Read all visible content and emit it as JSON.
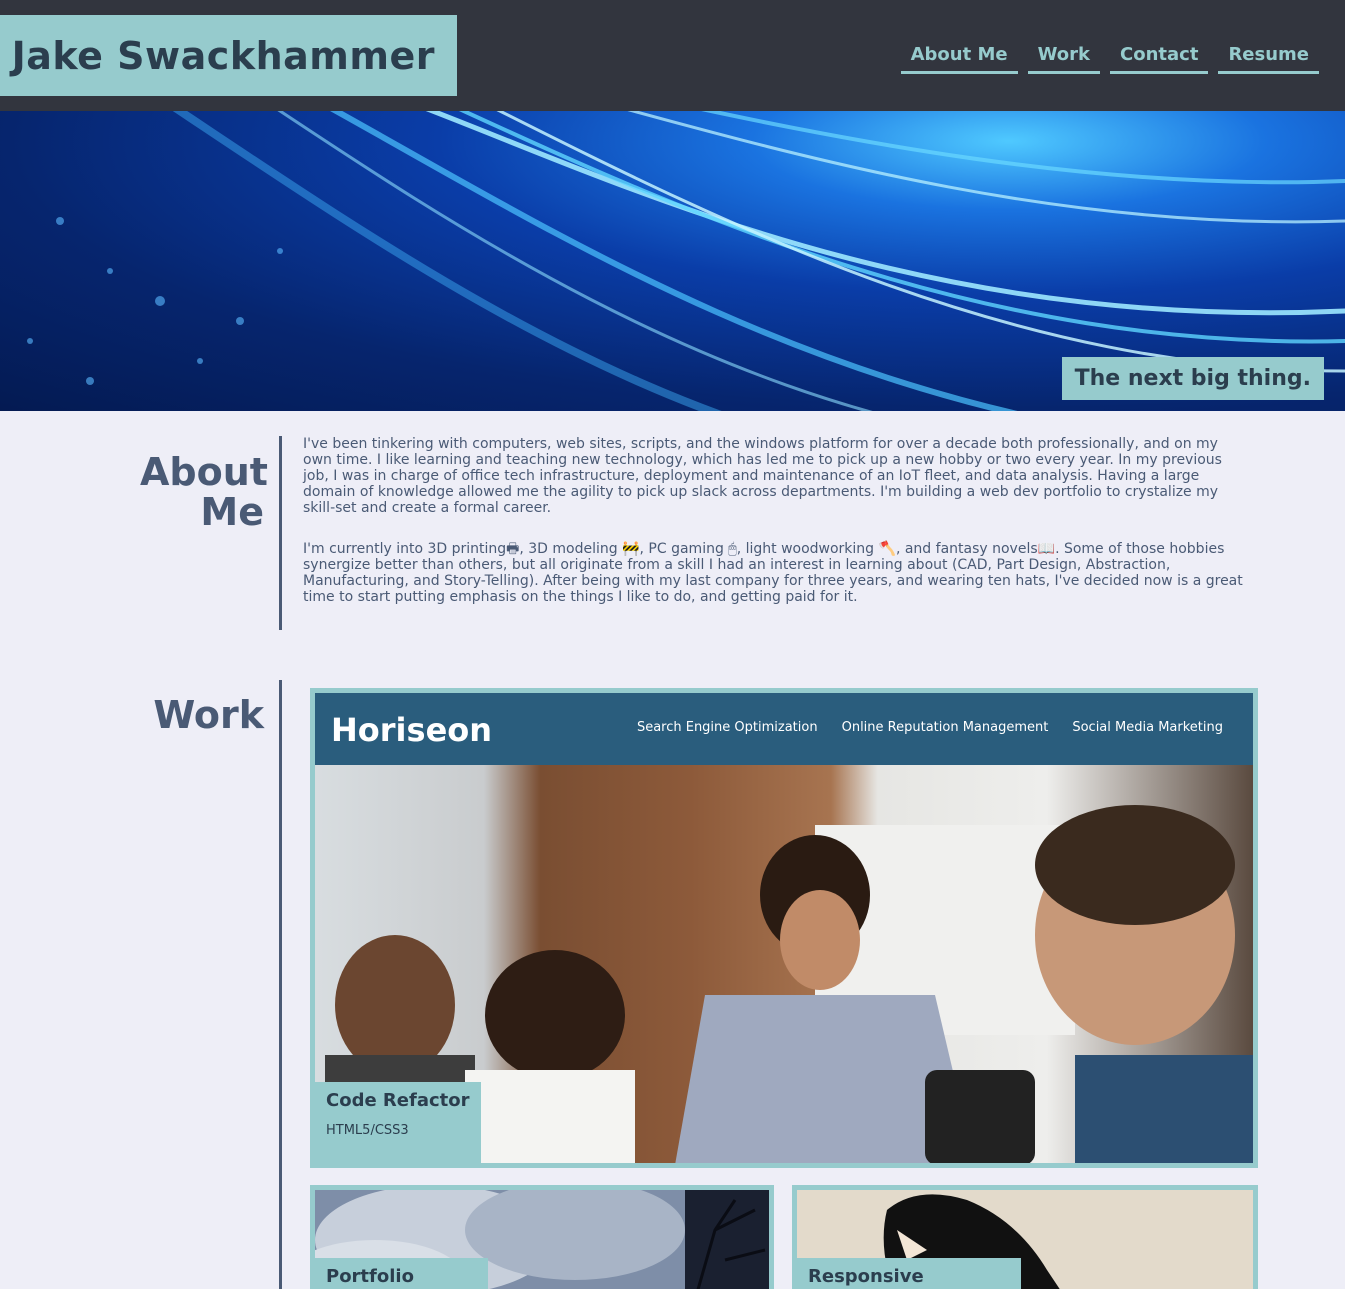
{
  "header": {
    "brand": "Jake Swackhammer",
    "nav": [
      "About Me",
      "Work",
      "Contact",
      "Resume"
    ]
  },
  "hero": {
    "tagline": "The next big thing."
  },
  "about": {
    "title_line1": "About",
    "title_line2": "Me",
    "paragraph1": "I've been tinkering with computers, web sites, scripts, and the windows platform for over a decade both professionally, and on my own time. I like learning and teaching new technology, which has led me to pick up a new hobby or two every year. In my previous job, I was in charge of office tech infrastructure, deployment and maintenance of an IoT fleet, and data analysis. Having a large domain of knowledge allowed me the agility to pick up slack across departments. I'm building a web dev portfolio to crystalize my skill-set and create a formal career.",
    "paragraph2": "I'm currently into 3D printing🖶, 3D modeling 🚧, PC gaming 🖱, light woodworking 🪓, and fantasy novels📖. Some of those hobbies synergize better than others, but all originate from a skill I had an interest in learning about (CAD, Part Design, Abstraction, Manufacturing, and Story-Telling). After being with my last company for three years, and wearing ten hats, I've decided now is a great time to start putting emphasis on the things I like to do, and getting paid for it."
  },
  "work": {
    "title": "Work",
    "featured": {
      "title": "Code Refactor",
      "subtitle": "HTML5/CSS3",
      "site_logo": "Horiseon",
      "site_menu": [
        "Search Engine Optimization",
        "Online Reputation Management",
        "Social Media Marketing"
      ]
    },
    "cards": [
      {
        "title": "Portfolio"
      },
      {
        "title": "Responsive BootStrap"
      }
    ]
  }
}
